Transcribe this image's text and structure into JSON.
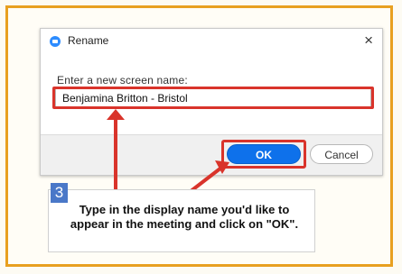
{
  "dialog": {
    "title": "Rename",
    "close_glyph": "×",
    "prompt": "Enter a new screen name:",
    "name_value": "Benjamina Britton - Bristol",
    "ok_label": "OK",
    "cancel_label": "Cancel"
  },
  "callout": {
    "step": "3",
    "text": "Type in the display name you'd like to appear in the meeting and click on \"OK\"."
  },
  "colors": {
    "frame_border": "#e8a020",
    "highlight": "#d9342b",
    "ok_button": "#0e71eb",
    "badge": "#4a78c8"
  }
}
